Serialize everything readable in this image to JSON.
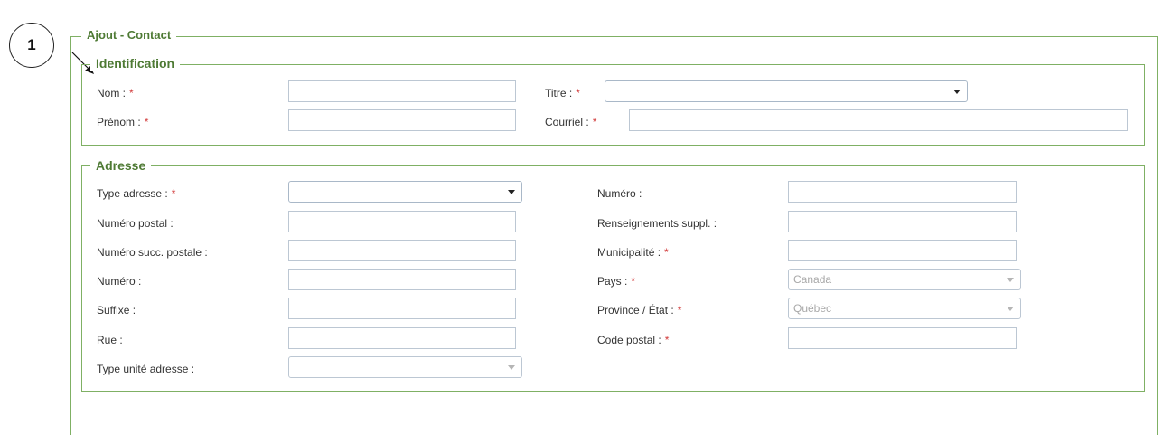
{
  "callout": {
    "number": "1"
  },
  "form": {
    "title": "Ajout - Contact"
  },
  "identification": {
    "title": "Identification",
    "nom": {
      "label": "Nom :",
      "required": "*",
      "value": ""
    },
    "prenom": {
      "label": "Prénom :",
      "required": "*",
      "value": ""
    },
    "titre": {
      "label": "Titre :",
      "required": "*",
      "value": ""
    },
    "courriel": {
      "label": "Courriel :",
      "required": "*",
      "value": ""
    }
  },
  "adresse": {
    "title": "Adresse",
    "type_adresse": {
      "label": "Type adresse :",
      "required": "*",
      "value": ""
    },
    "numero_postal": {
      "label": "Numéro postal :",
      "value": ""
    },
    "numero_succ": {
      "label": "Numéro succ. postale :",
      "value": ""
    },
    "numero_left": {
      "label": "Numéro :",
      "value": ""
    },
    "suffixe": {
      "label": "Suffixe :",
      "value": ""
    },
    "rue": {
      "label": "Rue :",
      "value": ""
    },
    "type_unite": {
      "label": "Type unité adresse :",
      "value": ""
    },
    "numero_right": {
      "label": "Numéro :",
      "value": ""
    },
    "renseignements": {
      "label": "Renseignements suppl. :",
      "value": ""
    },
    "municipalite": {
      "label": "Municipalité :",
      "required": "*",
      "value": ""
    },
    "pays": {
      "label": "Pays :",
      "required": "*",
      "value": "Canada"
    },
    "province": {
      "label": "Province / État :",
      "required": "*",
      "value": "Québec"
    },
    "code_postal": {
      "label": "Code postal :",
      "required": "*",
      "value": ""
    }
  },
  "colors": {
    "border": "#7fb064",
    "title": "#4e7a34",
    "required": "#d23b3b"
  }
}
